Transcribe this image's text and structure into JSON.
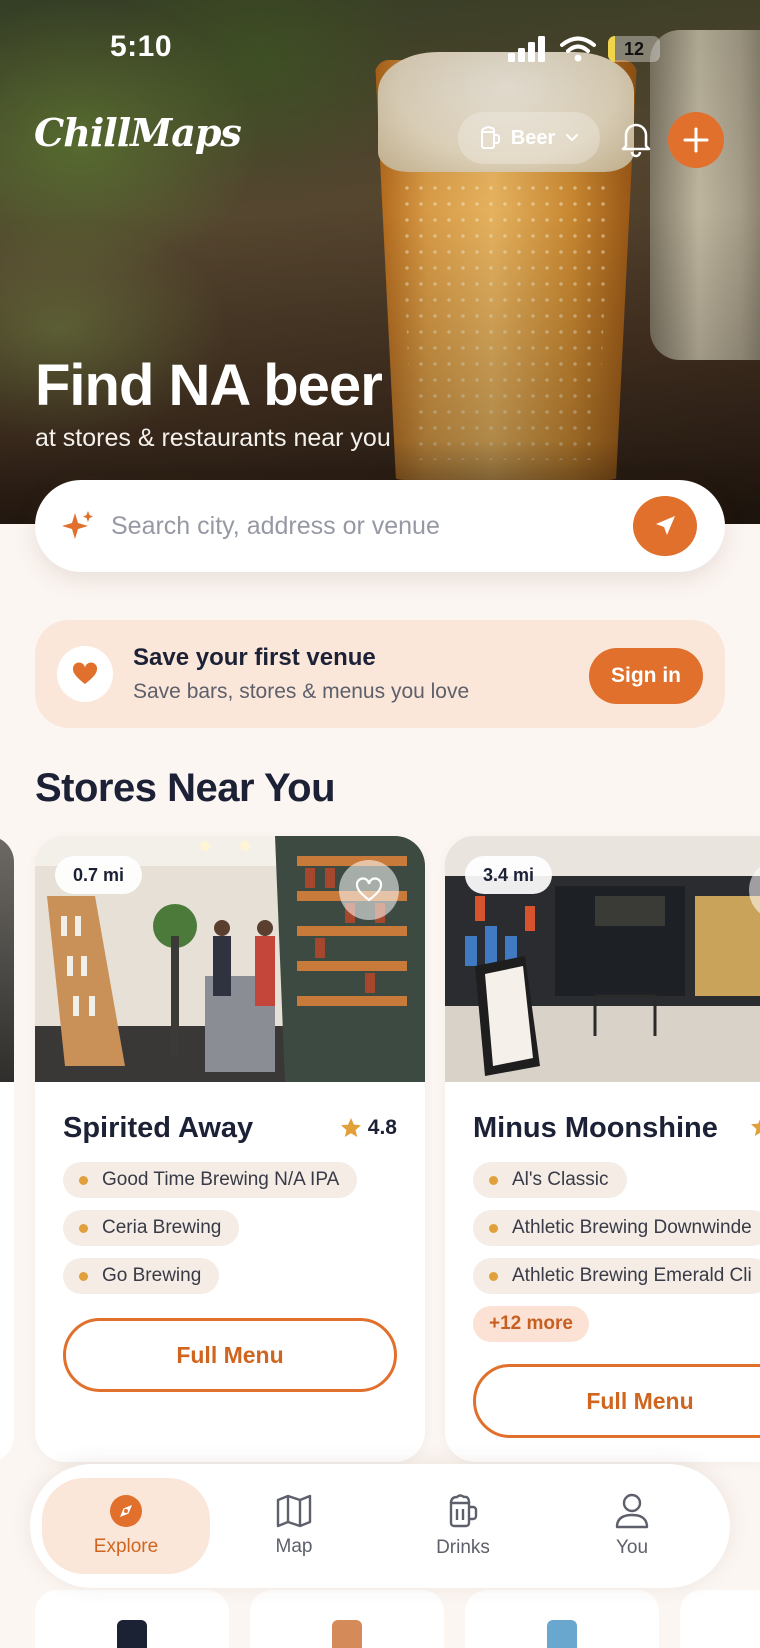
{
  "status_bar": {
    "time": "5:10",
    "battery": "12"
  },
  "header": {
    "logo": "ChillMaps",
    "drink_filter": "Beer"
  },
  "hero": {
    "title": "Find NA beer",
    "subtitle": "at stores & restaurants near you"
  },
  "search": {
    "placeholder": "Search city, address or venue"
  },
  "save_banner": {
    "title": "Save your first venue",
    "subtitle": "Save bars, stores & menus you love",
    "button": "Sign in"
  },
  "section_title": "Stores Near You",
  "stores": [
    {
      "distance": "0.7 mi",
      "name": "Spirited Away",
      "rating": "4.8",
      "items": [
        "Good Time Brewing N/A IPA",
        "Ceria Brewing",
        "Go Brewing"
      ],
      "button": "Full Menu"
    },
    {
      "distance": "3.4 mi",
      "name": "Minus Moonshine",
      "items": [
        "Al's Classic",
        "Athletic Brewing Downwinde",
        "Athletic Brewing Emerald Cli"
      ],
      "more": "+12 more",
      "button": "Full Menu"
    }
  ],
  "nav": {
    "items": [
      {
        "label": "Explore",
        "icon": "compass-icon"
      },
      {
        "label": "Map",
        "icon": "map-icon"
      },
      {
        "label": "Drinks",
        "icon": "beer-mug-icon"
      },
      {
        "label": "You",
        "icon": "user-icon"
      }
    ]
  },
  "colors": {
    "accent": "#e0702b",
    "background": "#fcf6f2",
    "banner": "#fbe6da"
  }
}
